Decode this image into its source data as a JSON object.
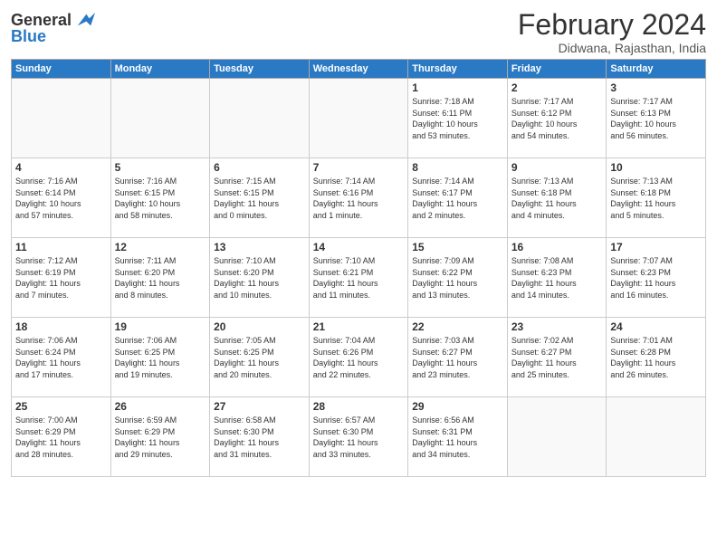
{
  "logo": {
    "general": "General",
    "blue": "Blue"
  },
  "title": "February 2024",
  "subtitle": "Didwana, Rajasthan, India",
  "days_of_week": [
    "Sunday",
    "Monday",
    "Tuesday",
    "Wednesday",
    "Thursday",
    "Friday",
    "Saturday"
  ],
  "weeks": [
    [
      {
        "day": "",
        "info": ""
      },
      {
        "day": "",
        "info": ""
      },
      {
        "day": "",
        "info": ""
      },
      {
        "day": "",
        "info": ""
      },
      {
        "day": "1",
        "info": "Sunrise: 7:18 AM\nSunset: 6:11 PM\nDaylight: 10 hours\nand 53 minutes."
      },
      {
        "day": "2",
        "info": "Sunrise: 7:17 AM\nSunset: 6:12 PM\nDaylight: 10 hours\nand 54 minutes."
      },
      {
        "day": "3",
        "info": "Sunrise: 7:17 AM\nSunset: 6:13 PM\nDaylight: 10 hours\nand 56 minutes."
      }
    ],
    [
      {
        "day": "4",
        "info": "Sunrise: 7:16 AM\nSunset: 6:14 PM\nDaylight: 10 hours\nand 57 minutes."
      },
      {
        "day": "5",
        "info": "Sunrise: 7:16 AM\nSunset: 6:15 PM\nDaylight: 10 hours\nand 58 minutes."
      },
      {
        "day": "6",
        "info": "Sunrise: 7:15 AM\nSunset: 6:15 PM\nDaylight: 11 hours\nand 0 minutes."
      },
      {
        "day": "7",
        "info": "Sunrise: 7:14 AM\nSunset: 6:16 PM\nDaylight: 11 hours\nand 1 minute."
      },
      {
        "day": "8",
        "info": "Sunrise: 7:14 AM\nSunset: 6:17 PM\nDaylight: 11 hours\nand 2 minutes."
      },
      {
        "day": "9",
        "info": "Sunrise: 7:13 AM\nSunset: 6:18 PM\nDaylight: 11 hours\nand 4 minutes."
      },
      {
        "day": "10",
        "info": "Sunrise: 7:13 AM\nSunset: 6:18 PM\nDaylight: 11 hours\nand 5 minutes."
      }
    ],
    [
      {
        "day": "11",
        "info": "Sunrise: 7:12 AM\nSunset: 6:19 PM\nDaylight: 11 hours\nand 7 minutes."
      },
      {
        "day": "12",
        "info": "Sunrise: 7:11 AM\nSunset: 6:20 PM\nDaylight: 11 hours\nand 8 minutes."
      },
      {
        "day": "13",
        "info": "Sunrise: 7:10 AM\nSunset: 6:20 PM\nDaylight: 11 hours\nand 10 minutes."
      },
      {
        "day": "14",
        "info": "Sunrise: 7:10 AM\nSunset: 6:21 PM\nDaylight: 11 hours\nand 11 minutes."
      },
      {
        "day": "15",
        "info": "Sunrise: 7:09 AM\nSunset: 6:22 PM\nDaylight: 11 hours\nand 13 minutes."
      },
      {
        "day": "16",
        "info": "Sunrise: 7:08 AM\nSunset: 6:23 PM\nDaylight: 11 hours\nand 14 minutes."
      },
      {
        "day": "17",
        "info": "Sunrise: 7:07 AM\nSunset: 6:23 PM\nDaylight: 11 hours\nand 16 minutes."
      }
    ],
    [
      {
        "day": "18",
        "info": "Sunrise: 7:06 AM\nSunset: 6:24 PM\nDaylight: 11 hours\nand 17 minutes."
      },
      {
        "day": "19",
        "info": "Sunrise: 7:06 AM\nSunset: 6:25 PM\nDaylight: 11 hours\nand 19 minutes."
      },
      {
        "day": "20",
        "info": "Sunrise: 7:05 AM\nSunset: 6:25 PM\nDaylight: 11 hours\nand 20 minutes."
      },
      {
        "day": "21",
        "info": "Sunrise: 7:04 AM\nSunset: 6:26 PM\nDaylight: 11 hours\nand 22 minutes."
      },
      {
        "day": "22",
        "info": "Sunrise: 7:03 AM\nSunset: 6:27 PM\nDaylight: 11 hours\nand 23 minutes."
      },
      {
        "day": "23",
        "info": "Sunrise: 7:02 AM\nSunset: 6:27 PM\nDaylight: 11 hours\nand 25 minutes."
      },
      {
        "day": "24",
        "info": "Sunrise: 7:01 AM\nSunset: 6:28 PM\nDaylight: 11 hours\nand 26 minutes."
      }
    ],
    [
      {
        "day": "25",
        "info": "Sunrise: 7:00 AM\nSunset: 6:29 PM\nDaylight: 11 hours\nand 28 minutes."
      },
      {
        "day": "26",
        "info": "Sunrise: 6:59 AM\nSunset: 6:29 PM\nDaylight: 11 hours\nand 29 minutes."
      },
      {
        "day": "27",
        "info": "Sunrise: 6:58 AM\nSunset: 6:30 PM\nDaylight: 11 hours\nand 31 minutes."
      },
      {
        "day": "28",
        "info": "Sunrise: 6:57 AM\nSunset: 6:30 PM\nDaylight: 11 hours\nand 33 minutes."
      },
      {
        "day": "29",
        "info": "Sunrise: 6:56 AM\nSunset: 6:31 PM\nDaylight: 11 hours\nand 34 minutes."
      },
      {
        "day": "",
        "info": ""
      },
      {
        "day": "",
        "info": ""
      }
    ]
  ]
}
